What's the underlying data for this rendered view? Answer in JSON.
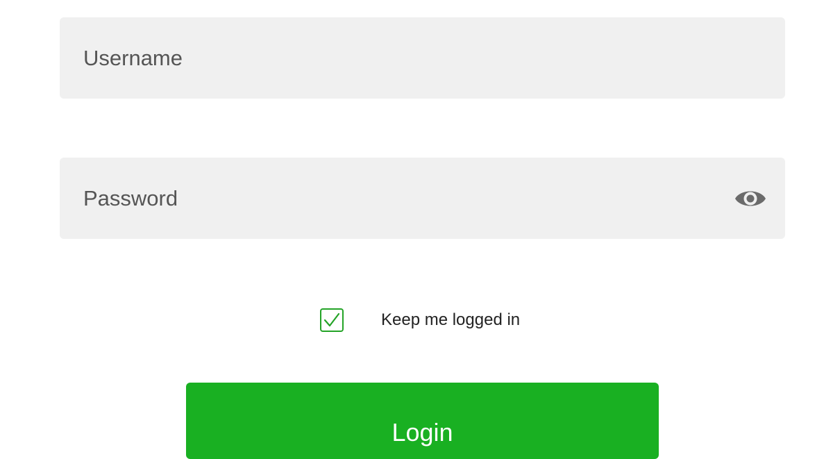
{
  "form": {
    "username": {
      "value": "",
      "placeholder": "Username"
    },
    "password": {
      "value": "",
      "placeholder": "Password",
      "visibility_icon": "eye-icon"
    },
    "remember_me": {
      "label": "Keep me logged in",
      "checked": true,
      "icon": "checkmark-icon"
    },
    "login_label": "Login"
  },
  "colors": {
    "accent": "#19b022",
    "checkbox_border": "#23a326",
    "field_background": "#f0f0f0",
    "icon": "#6b6b6b"
  }
}
